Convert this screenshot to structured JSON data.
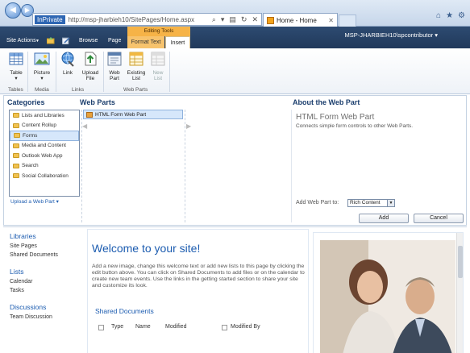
{
  "browser": {
    "inprivate_label": "InPrivate",
    "url_host": "http://msp-jharbieh10",
    "url_path": "/SitePages/Home.aspx",
    "tab_title": "Home - Home"
  },
  "ribbon": {
    "site_actions": "Site Actions",
    "browse_tab": "Browse",
    "page_tab": "Page",
    "contextual_group": "Editing Tools",
    "format_text_tab": "Format Text",
    "insert_tab": "Insert",
    "user": "MSP-JHARBIEH10\\spcontributor",
    "buttons": {
      "table": "Table",
      "picture": "Picture",
      "link": "Link",
      "upload_file": "Upload File",
      "web_part": "Web Part",
      "existing_list": "Existing List",
      "new_list": "New List"
    },
    "groups": {
      "tables": "Tables",
      "media": "Media",
      "links": "Links",
      "web_parts": "Web Parts"
    }
  },
  "picker": {
    "categories_title": "Categories",
    "webparts_title": "Web Parts",
    "about_title": "About the Web Part",
    "categories": [
      "Lists and Libraries",
      "Content Rollup",
      "Forms",
      "Media and Content",
      "Outlook Web App",
      "Search",
      "Social Collaboration"
    ],
    "selected_category": "Forms",
    "upload_link": "Upload a Web Part",
    "webparts": [
      "HTML Form Web Part"
    ],
    "selected_webpart_title": "HTML Form Web Part",
    "selected_webpart_desc": "Connects simple form controls to other Web Parts.",
    "add_to_label": "Add Web Part to:",
    "add_to_value": "Rich Content",
    "add_button": "Add",
    "cancel_button": "Cancel"
  },
  "page": {
    "quicklaunch": {
      "libraries_head": "Libraries",
      "libraries": [
        "Site Pages",
        "Shared Documents"
      ],
      "lists_head": "Lists",
      "lists": [
        "Calendar",
        "Tasks"
      ],
      "discussions_head": "Discussions",
      "discussions": [
        "Team Discussion"
      ]
    },
    "welcome_title": "Welcome to your site!",
    "welcome_text": "Add a new image, change this welcome text or add new lists to this page by clicking the edit button above. You can click on Shared Documents to add files or on the calendar to create new team events. Use the links in the getting started section to share your site and customize its look.",
    "shared_docs_title": "Shared Documents",
    "columns": [
      "Type",
      "Name",
      "Modified",
      "Modified By"
    ]
  },
  "colors": {
    "ribbon_header": "#21395b",
    "contextual_tab": "#f6b347",
    "link_blue": "#1c5cb0"
  }
}
